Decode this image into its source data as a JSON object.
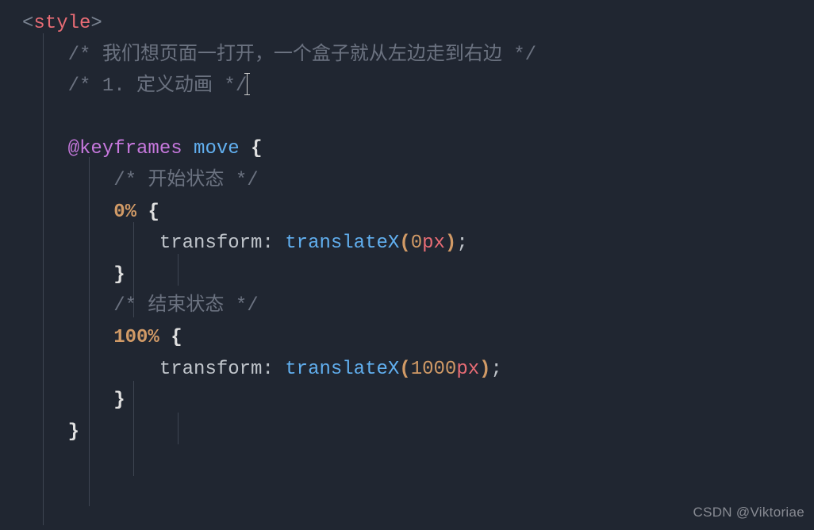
{
  "code": {
    "tag_open_lt": "<",
    "tag_name": "style",
    "tag_open_gt": ">",
    "comment1": "/* 我们想页面一打开，一个盒子就从左边走到右边 */",
    "comment2_a": "/* 1. 定义动画 */",
    "at_keyframes": "@keyframes",
    "animation_name": "move",
    "brace_open": "{",
    "brace_close": "}",
    "comment3": "/* 开始状态 */",
    "key_0": "0%",
    "property": "transform",
    "colon": ":",
    "value_fn": "translateX",
    "paren_open": "(",
    "val_0_num": "0",
    "val_0_unit": "px",
    "paren_close": ")",
    "semicolon": ";",
    "comment4": "/* 结束状态 */",
    "key_100": "100%",
    "val_1000_num": "1000",
    "val_1000_unit": "px"
  },
  "watermark": "CSDN @Viktoriae"
}
